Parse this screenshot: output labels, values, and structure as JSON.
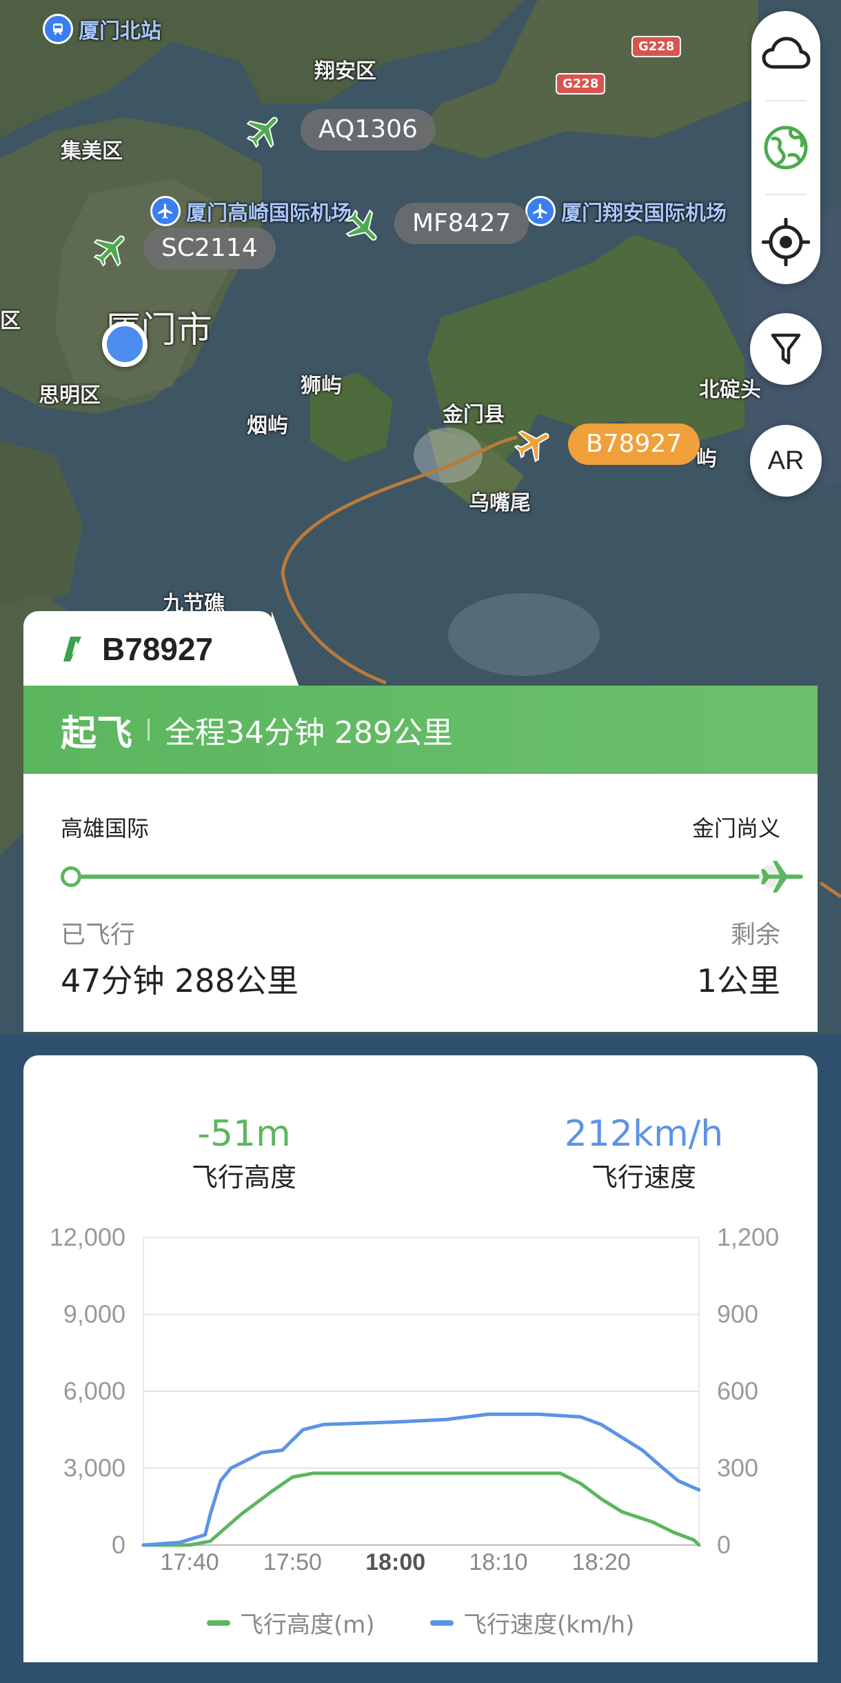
{
  "map": {
    "labels": {
      "xiamen_north_station": "厦门北站",
      "xiangan_district": "翔安区",
      "jimei_district": "集美区",
      "xiamen_gaoqi_airport": "厦门高崎国际机场",
      "xiamen_xiangan_airport": "厦门翔安国际机场",
      "xiamen_city": "厦门市",
      "district_partial": "区",
      "siming_district": "思明区",
      "shiyu": "狮屿",
      "yanyu": "烟屿",
      "jinmen_county": "金门县",
      "wuzhuowei": "乌嘴尾",
      "beipitou": "北碇头",
      "jiujiejiao": "九节礁",
      "island_partial": "屿",
      "road_g228_a": "G228",
      "road_g228_b": "G228"
    },
    "flights": [
      "AQ1306",
      "MF8427",
      "SC2114",
      "B78927"
    ],
    "active_flight": "B78927"
  },
  "toolbar": {
    "weather": "cloud-icon",
    "layers": "globe-icon",
    "locate": "crosshair-icon",
    "filter": "filter-icon",
    "ar_label": "AR"
  },
  "flight": {
    "number": "B78927",
    "status": "起飞",
    "summary": "全程34分钟 289公里",
    "origin": "高雄国际",
    "destination": "金门尚义",
    "progress": 0.997,
    "flown_caption": "已飞行",
    "flown_value": "47分钟 288公里",
    "remaining_caption": "剩余",
    "remaining_value": "1公里"
  },
  "stats": {
    "altitude_value": "-51m",
    "altitude_label": "飞行高度",
    "speed_value": "212km/h",
    "speed_label": "飞行速度"
  },
  "colors": {
    "green": "#5bb65e",
    "blue": "#5b93e6",
    "orange": "#f0a03a"
  },
  "chart_data": {
    "type": "line",
    "x_ticks": [
      "17:40",
      "17:50",
      "18:00",
      "18:10",
      "18:20"
    ],
    "x_range_minutes": [
      "17:35:30",
      "18:29:30"
    ],
    "y_left_ticks": [
      "12,000",
      "9,000",
      "6,000",
      "3,000",
      "0"
    ],
    "y_left_range": [
      0,
      12000
    ],
    "y_right_ticks": [
      "1,200",
      "900",
      "600",
      "300",
      "0"
    ],
    "y_right_range": [
      0,
      1200
    ],
    "grid": true,
    "legend_position": "bottom",
    "series": [
      {
        "name": "飞行高度(m)",
        "axis": "left",
        "x": [
          "17:35:30",
          "17:40:00",
          "17:42:00",
          "17:45:00",
          "17:48:00",
          "17:50:00",
          "17:52:00",
          "18:00:00",
          "18:10:00",
          "18:14:00",
          "18:16:00",
          "18:18:00",
          "18:20:00",
          "18:22:00",
          "18:25:00",
          "18:27:00",
          "18:29:00",
          "18:29:30"
        ],
        "values": [
          0,
          0,
          150,
          1200,
          2100,
          2650,
          2800,
          2800,
          2800,
          2800,
          2800,
          2400,
          1800,
          1300,
          900,
          500,
          200,
          0
        ]
      },
      {
        "name": "飞行速度(km/h)",
        "axis": "right",
        "x": [
          "17:35:30",
          "17:39:00",
          "17:41:30",
          "17:42:00",
          "17:43:00",
          "17:44:00",
          "17:45:00",
          "17:47:00",
          "17:49:00",
          "17:51:00",
          "17:53:00",
          "18:00:00",
          "18:05:00",
          "18:09:00",
          "18:14:00",
          "18:18:00",
          "18:20:00",
          "18:22:00",
          "18:24:00",
          "18:26:00",
          "18:27:30",
          "18:29:30"
        ],
        "values": [
          0,
          10,
          40,
          120,
          250,
          300,
          320,
          360,
          370,
          450,
          470,
          480,
          490,
          510,
          510,
          500,
          470,
          420,
          370,
          300,
          250,
          215
        ]
      }
    ]
  }
}
